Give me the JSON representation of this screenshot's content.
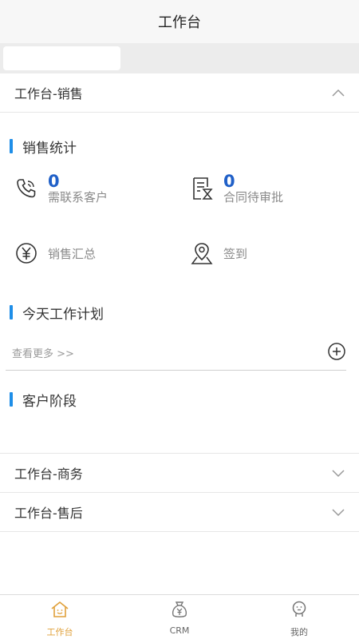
{
  "header": {
    "title": "工作台"
  },
  "sections": {
    "sales": {
      "label": "工作台-销售"
    },
    "business": {
      "label": "工作台-商务"
    },
    "aftersale": {
      "label": "工作台-售后"
    }
  },
  "sales_stats": {
    "title": "销售统计",
    "contact": {
      "count": "0",
      "label": "需联系客户"
    },
    "contract": {
      "count": "0",
      "label": "合同待审批"
    },
    "summary": {
      "label": "销售汇总"
    },
    "checkin": {
      "label": "签到"
    }
  },
  "plan": {
    "title": "今天工作计划",
    "more": "查看更多 >>"
  },
  "stage": {
    "title": "客户阶段"
  },
  "tabbar": {
    "items": [
      {
        "label": "工作台",
        "icon": "home-icon",
        "active": true
      },
      {
        "label": "CRM",
        "icon": "money-bag-icon",
        "active": false
      },
      {
        "label": "我的",
        "icon": "profile-icon",
        "active": false
      }
    ]
  },
  "colors": {
    "accent_bar": "#1e8ee8",
    "count_blue": "#2060c8",
    "tab_active": "#e0a03a"
  }
}
